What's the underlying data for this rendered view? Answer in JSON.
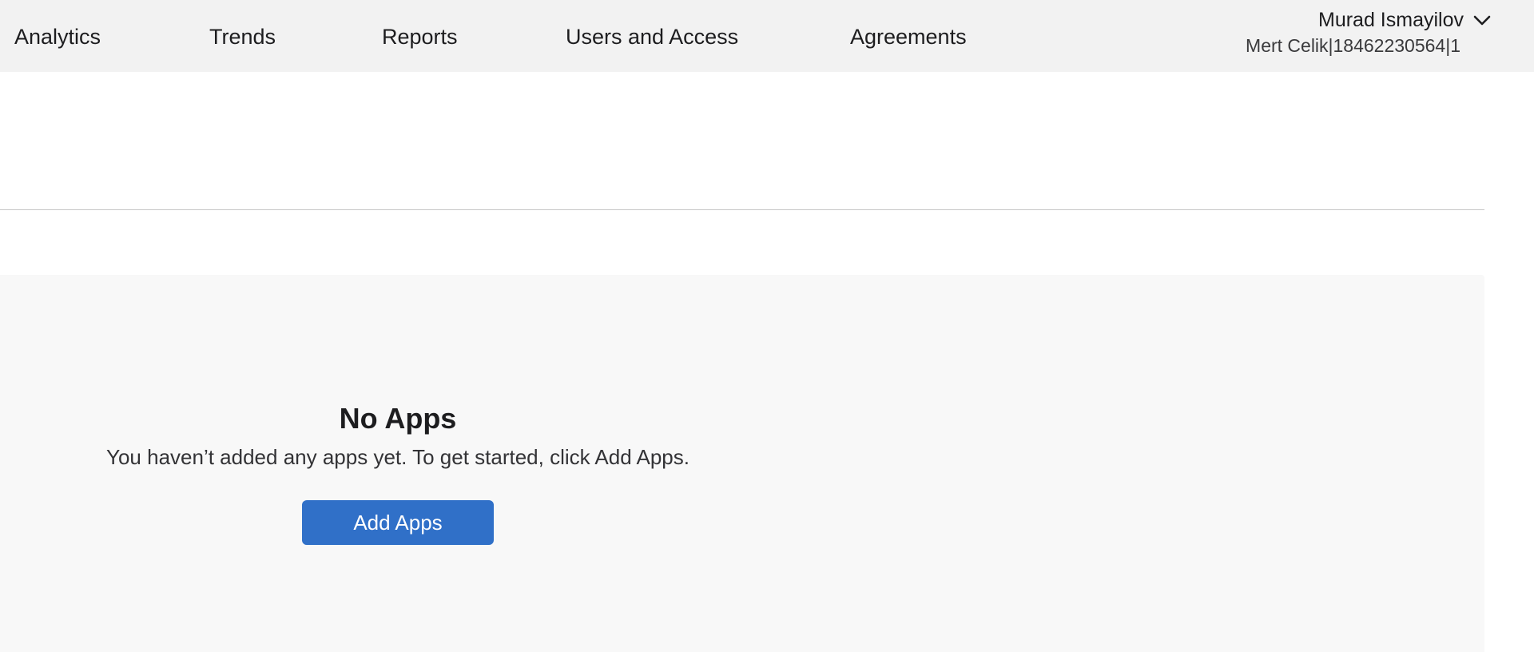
{
  "nav": {
    "items": [
      {
        "label": "Analytics"
      },
      {
        "label": "Trends"
      },
      {
        "label": "Reports"
      },
      {
        "label": "Users and Access"
      },
      {
        "label": "Agreements"
      }
    ]
  },
  "account": {
    "user_name": "Murad Ismayilov",
    "team_info": "Mert Celik|18462230564|1",
    "menu_icon": "chevron-down-icon"
  },
  "empty_state": {
    "title": "No Apps",
    "message": "You haven’t added any apps yet. To get started, click Add Apps.",
    "button_label": "Add Apps"
  },
  "colors": {
    "topbar_bg": "#f2f2f2",
    "panel_bg": "#f8f8f8",
    "primary_button": "#3070c8"
  }
}
